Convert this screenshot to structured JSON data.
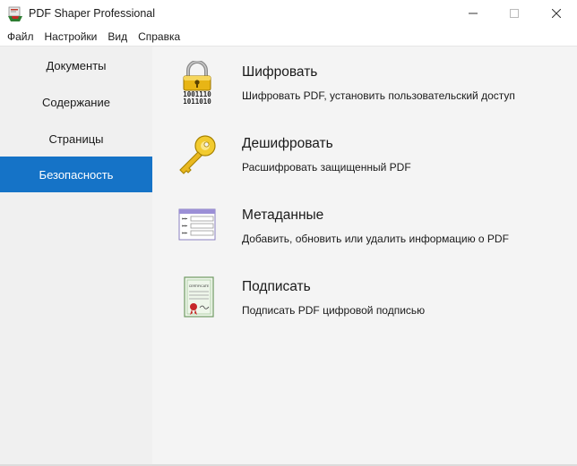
{
  "window": {
    "title": "PDF Shaper Professional",
    "app_icon": "pdf-shaper-icon",
    "controls": [
      "minimize-icon",
      "maximize-icon",
      "close-icon"
    ]
  },
  "menu": {
    "items": [
      {
        "label": "Файл"
      },
      {
        "label": "Настройки"
      },
      {
        "label": "Вид"
      },
      {
        "label": "Справка"
      }
    ]
  },
  "sidebar": {
    "items": [
      {
        "label": "Документы",
        "active": false
      },
      {
        "label": "Содержание",
        "active": false
      },
      {
        "label": "Страницы",
        "active": false
      },
      {
        "label": "Безопасность",
        "active": true
      }
    ]
  },
  "features": [
    {
      "title": "Шифровать",
      "description": "Шифровать PDF, установить пользовательский доступ",
      "icon": "padlock-icon",
      "icon_text": [
        "1001110",
        "1011010"
      ]
    },
    {
      "title": "Дешифровать",
      "description": "Расшифровать защищенный PDF",
      "icon": "key-icon"
    },
    {
      "title": "Метаданные",
      "description": "Добавить, обновить или удалить информацию о PDF",
      "icon": "metadata-icon"
    },
    {
      "title": "Подписать",
      "description": "Подписать PDF цифровой подписью",
      "icon": "certificate-icon",
      "icon_text": [
        "CERTIFICATE"
      ]
    }
  ],
  "colors": {
    "active_nav": "#1573c7",
    "sidebar_bg": "#f0f0f0",
    "content_bg": "#f4f4f4"
  }
}
